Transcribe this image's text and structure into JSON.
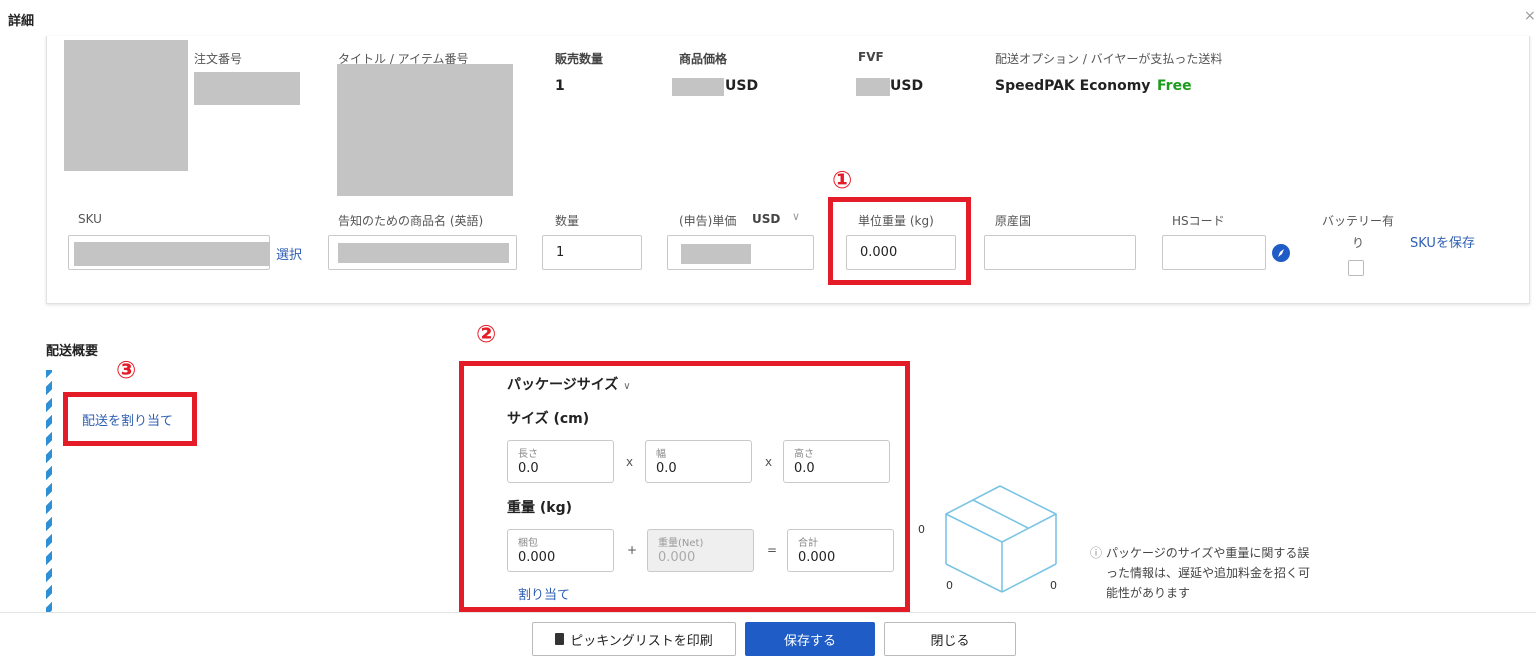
{
  "dialog": {
    "title": "詳細",
    "close_label": "×"
  },
  "order_headers": {
    "order_no": "注文番号",
    "title_item_no": "タイトル / アイテム番号",
    "qty_sold": "販売数量",
    "price": "商品価格",
    "fvf": "FVF",
    "shipping": "配送オプション / バイヤーが支払った送料"
  },
  "order_values": {
    "qty_sold": "1",
    "price_currency": "USD",
    "fvf_currency": "USD",
    "shipping_option": "SpeedPAK Economy",
    "shipping_fee": "Free"
  },
  "sku_headers": {
    "sku": "SKU",
    "customs_name": "告知のための商品名 (英語)",
    "quantity": "数量",
    "unit_price": "(申告)単価",
    "unit_price_currency": "USD",
    "unit_weight": "単位重量 (kg)",
    "origin": "原産国",
    "hs_code": "HSコード",
    "battery_line1": "バッテリー有",
    "battery_line2": "り"
  },
  "sku_values": {
    "select_link": "選択",
    "quantity": "1",
    "unit_weight": "0.000",
    "save_sku_link": "SKUを保存"
  },
  "annotations": {
    "one": "①",
    "two": "②",
    "three": "③"
  },
  "shipping_summary": {
    "title": "配送概要",
    "assign_link": "配送を割り当て"
  },
  "package": {
    "size_dropdown": "パッケージサイズ",
    "size_heading": "サイズ (cm)",
    "length_label": "長さ",
    "length_value": "0.0",
    "width_label": "幅",
    "width_value": "0.0",
    "height_label": "高さ",
    "height_value": "0.0",
    "times": "x",
    "weight_heading": "重量 (kg)",
    "packing_label": "梱包",
    "packing_value": "0.000",
    "plus": "+",
    "net_label": "重量(Net)",
    "net_value": "0.000",
    "equals": "=",
    "total_label": "合計",
    "total_value": "0.000",
    "assign_link": "割り当て"
  },
  "box_graphic": {
    "top_value": "0",
    "left_value": "0",
    "right_value": "0"
  },
  "info": {
    "line1": "パッケージのサイズや重量に関する誤",
    "line2": "った情報は、遅延や追加料金を招く可",
    "line3": "能性があります"
  },
  "footer": {
    "print_button": "ピッキングリストを印刷",
    "save_button": "保存する",
    "close_button": "閉じる"
  },
  "colors": {
    "accent_blue": "#1f5cc6",
    "annotation_red": "#e41c27",
    "free_green": "#1a9c1a",
    "stripe_blue": "#2d8fd6"
  }
}
